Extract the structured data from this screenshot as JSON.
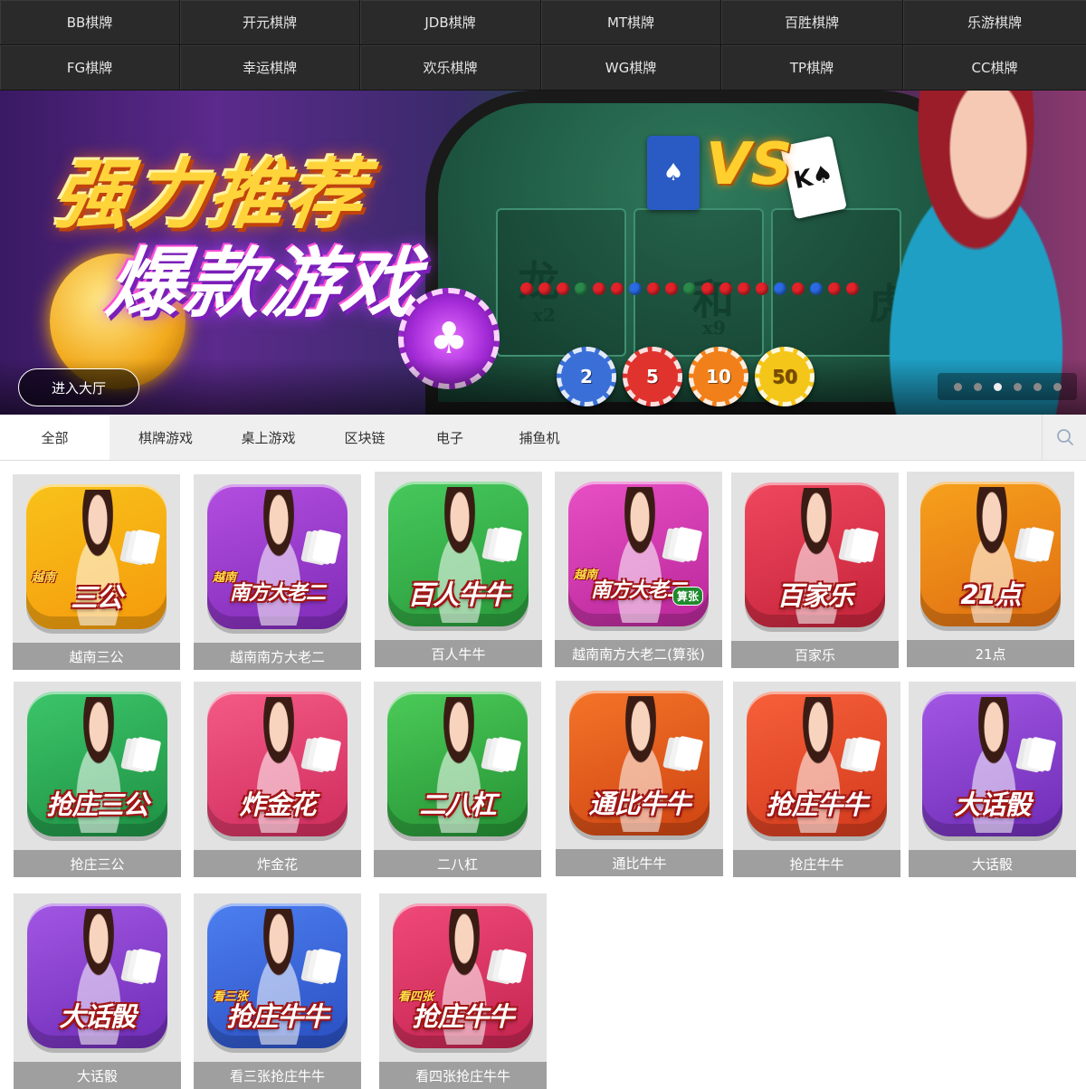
{
  "providers": [
    "BB棋牌",
    "开元棋牌",
    "JDB棋牌",
    "MT棋牌",
    "百胜棋牌",
    "乐游棋牌",
    "FG棋牌",
    "幸运棋牌",
    "欢乐棋牌",
    "WG棋牌",
    "TP棋牌",
    "CC棋牌"
  ],
  "banner": {
    "headline_1": "强力推荐",
    "headline_2": "爆款游戏",
    "vs_text": "VS",
    "panel_texts": [
      "龙",
      "和",
      "虎"
    ],
    "panel_multipliers": [
      "x2",
      "x9"
    ],
    "chips": [
      "2",
      "5",
      "10",
      "50"
    ],
    "enter_button": "进入大厅",
    "slide_count": 6,
    "active_slide": 3
  },
  "categories": [
    "全部",
    "棋牌游戏",
    "桌上游戏",
    "区块链",
    "电子",
    "捕鱼机"
  ],
  "active_category": "全部",
  "games": [
    {
      "label": "越南三公",
      "icon_title": "三公",
      "icon_tag": "越南",
      "color": "#f8c21a",
      "color2": "#f59a0c"
    },
    {
      "label": "越南南方大老二",
      "icon_title": "南方大老二",
      "icon_tag": "越南",
      "color": "#b34ee0",
      "color2": "#7f2bb8"
    },
    {
      "label": "百人牛牛",
      "icon_title": "百人牛牛",
      "icon_tag": "",
      "color": "#46c95c",
      "color2": "#2a9a3b"
    },
    {
      "label": "越南南方大老二(算张)",
      "icon_title": "南方大老二",
      "icon_tag": "越南",
      "extra_tag": "算张",
      "color": "#e84fc4",
      "color2": "#b8279a"
    },
    {
      "label": "百家乐",
      "icon_title": "百家乐",
      "icon_tag": "",
      "color": "#f0485e",
      "color2": "#c4233a"
    },
    {
      "label": "21点",
      "icon_title": "21点",
      "icon_tag": "",
      "color": "#f7a11c",
      "color2": "#df6d12"
    },
    {
      "label": "抢庄三公",
      "icon_title": "抢庄三公",
      "icon_tag": "",
      "color": "#3cc56a",
      "color2": "#1e9043"
    },
    {
      "label": "炸金花",
      "icon_title": "炸金花",
      "icon_tag": "",
      "color": "#f45a86",
      "color2": "#cf2c5c"
    },
    {
      "label": "二八杠",
      "icon_title": "二八杠",
      "icon_tag": "",
      "color": "#4bcb58",
      "color2": "#259134"
    },
    {
      "label": "通比牛牛",
      "icon_title": "通比牛牛",
      "icon_tag": "",
      "color": "#f47428",
      "color2": "#cf4412"
    },
    {
      "label": "抢庄牛牛",
      "icon_title": "抢庄牛牛",
      "icon_tag": "",
      "color": "#f7603a",
      "color2": "#d23a1c"
    },
    {
      "label": "大话骰",
      "icon_title": "大话骰",
      "icon_tag": "",
      "color": "#a257e3",
      "color2": "#6e2cb6"
    },
    {
      "label": "大话骰",
      "icon_title": "大话骰",
      "icon_tag": "",
      "color": "#a257e3",
      "color2": "#6e2cb6"
    },
    {
      "label": "看三张抢庄牛牛",
      "icon_title": "抢庄牛牛",
      "icon_tag": "看三张",
      "color": "#4d7ff0",
      "color2": "#2a4fc2"
    },
    {
      "label": "看四张抢庄牛牛",
      "icon_title": "抢庄牛牛",
      "icon_tag": "看四张",
      "color": "#f0497a",
      "color2": "#c4244f"
    }
  ],
  "icons": {
    "search": "search-icon"
  }
}
